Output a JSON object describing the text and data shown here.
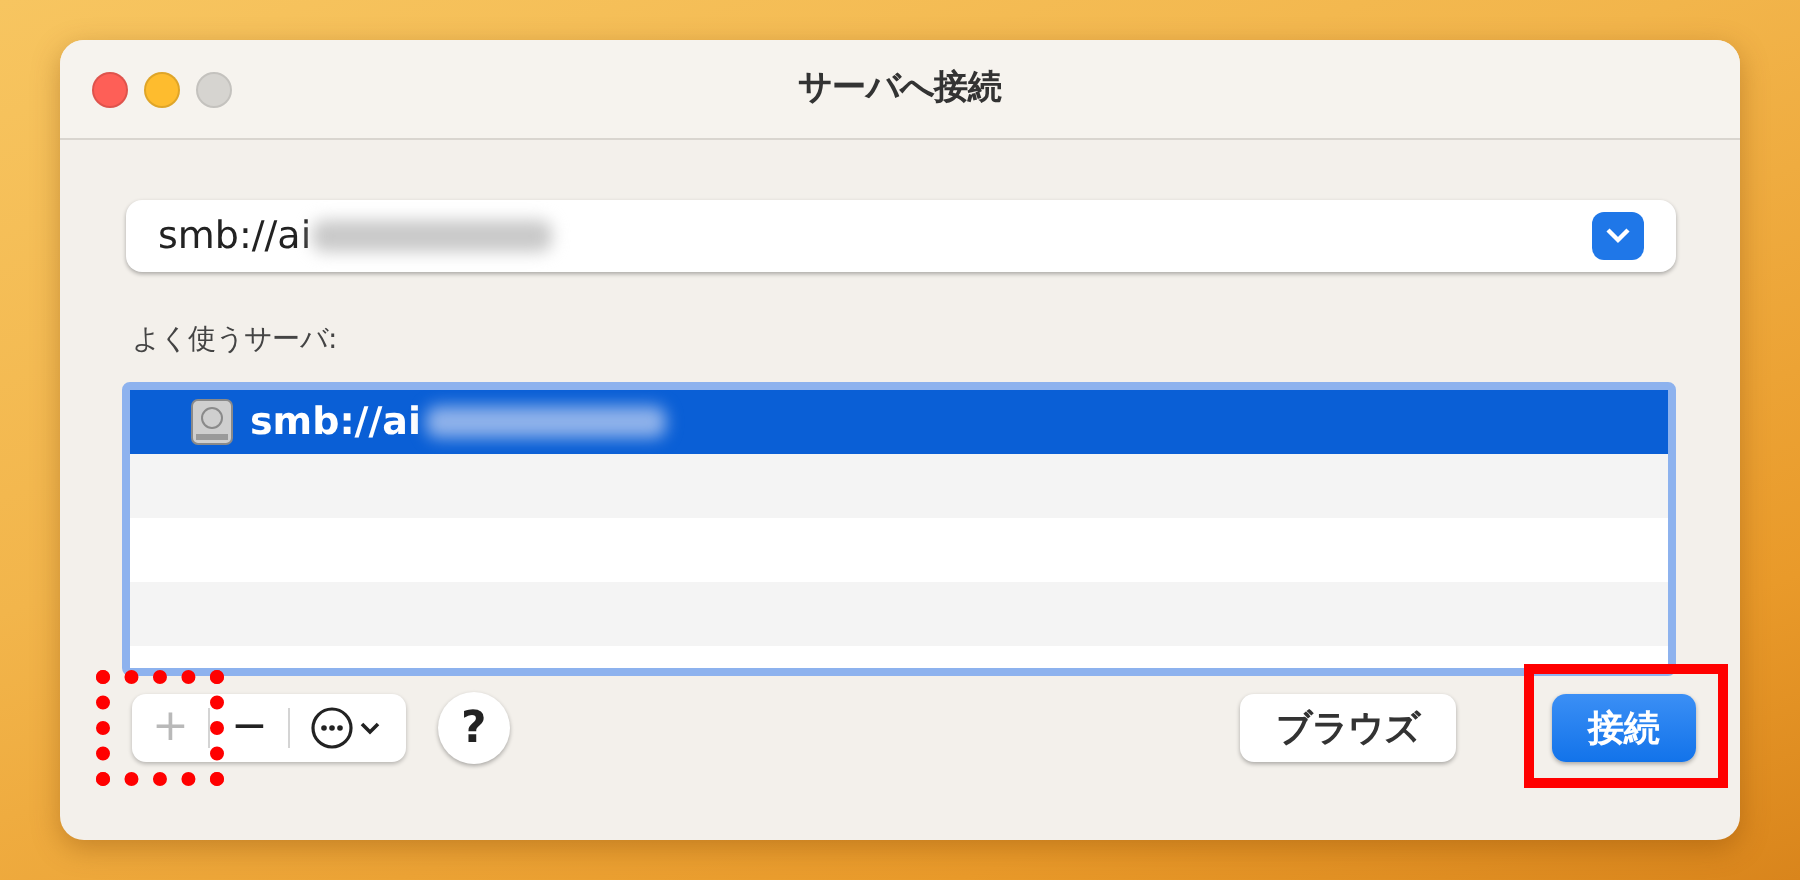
{
  "window": {
    "title": "サーバへ接続",
    "controls": [
      {
        "kind": "close",
        "disabled": false
      },
      {
        "kind": "minimize",
        "disabled": false
      },
      {
        "kind": "zoom",
        "disabled": true
      }
    ]
  },
  "address_field": {
    "value": "smb://ai",
    "redacted": true
  },
  "favorites": {
    "label": "よく使うサーバ:",
    "items": [
      {
        "label": "smb://ai",
        "selected": true,
        "redacted": true
      }
    ]
  },
  "toolbar": [
    {
      "kind": "add",
      "label": "+",
      "disabled": true,
      "annotated": true
    },
    {
      "kind": "remove",
      "label": "−",
      "disabled": false,
      "annotated": false
    },
    {
      "kind": "more",
      "disabled": false,
      "annotated": false
    }
  ],
  "help": {
    "label": "?"
  },
  "buttons": [
    {
      "label": "ブラウズ",
      "default": false,
      "annotated": false
    },
    {
      "label": "接続",
      "default": true,
      "annotated": true
    }
  ]
}
